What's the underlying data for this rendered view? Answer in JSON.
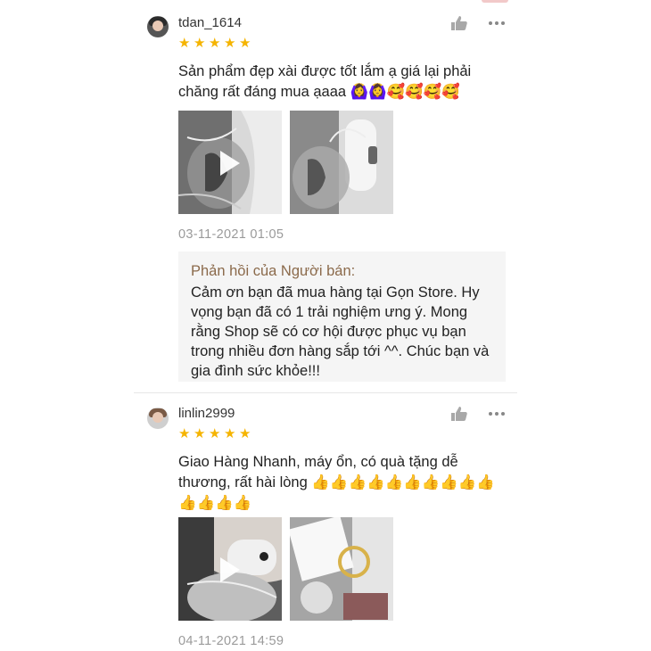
{
  "reviews": [
    {
      "username": "tdan_1614",
      "stars": 5,
      "comment": "Sản phẩm đẹp xài được tốt lắm ạ giá lại phải chăng rất đáng mua ạaaa 🙆‍♀️🙆‍♀️🥰🥰🥰🥰",
      "timestamp": "03-11-2021 01:05",
      "seller_reply": {
        "title": "Phản hồi của Người bán:",
        "body": "Cảm ơn bạn đã mua hàng tại Gọn Store. Hy vọng bạn đã có 1 trải nghiệm ưng ý. Mong rằng Shop sẽ có cơ hội được phục vụ bạn trong nhiều đơn hàng sắp tới ^^. Chúc bạn và gia đình sức khỏe!!!"
      }
    },
    {
      "username": "linlin2999",
      "stars": 5,
      "comment": "Giao Hàng Nhanh, máy ổn, có quà tặng dễ thương, rất hài lòng 👍👍👍👍👍👍👍👍👍👍👍👍👍👍",
      "timestamp": "04-11-2021 14:59"
    }
  ],
  "icons": {
    "like": "thumbs-up-icon",
    "more": "more-dots-icon",
    "star": "star-icon",
    "play": "play-icon"
  },
  "colors": {
    "star": "#f5b400",
    "reply_title": "#8b6a4b",
    "timestamp": "#9a9a9a"
  }
}
